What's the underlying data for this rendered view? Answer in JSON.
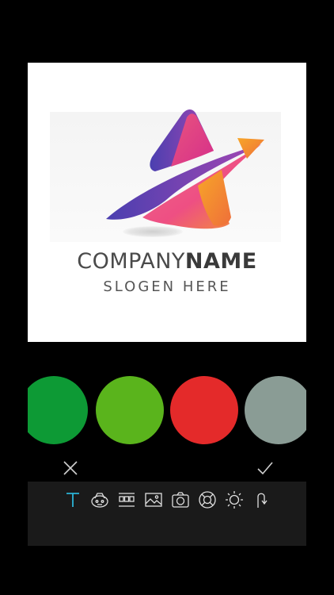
{
  "canvas": {
    "company_name_light": "COMPANY",
    "company_name_bold": "NAME",
    "slogan": "SLOGEN HERE"
  },
  "colors": {
    "logo_gradient": [
      "#e43e8c",
      "#f48a2c",
      "#5a3db4"
    ],
    "swatches": [
      "#0d9a35",
      "#5ab41c",
      "#e42a2a",
      "#8a9c95"
    ],
    "toolbar_active": "#2bb3d6",
    "toolbar_icon": "#e0e0e0"
  },
  "swatches": [
    {
      "name": "dark-green",
      "color": "#0d9a35"
    },
    {
      "name": "lime-green",
      "color": "#5ab41c"
    },
    {
      "name": "red",
      "color": "#e42a2a"
    },
    {
      "name": "gray",
      "color": "#8a9c95"
    }
  ],
  "actions": {
    "cancel_icon": "close-icon",
    "confirm_icon": "checkmark-icon"
  },
  "toolbar": {
    "tools": [
      {
        "icon": "text-icon",
        "active": true
      },
      {
        "icon": "sticker-icon",
        "active": false
      },
      {
        "icon": "layout-icon",
        "active": false
      },
      {
        "icon": "image-icon",
        "active": false
      },
      {
        "icon": "camera-icon",
        "active": false
      },
      {
        "icon": "lifebuoy-icon",
        "active": false
      },
      {
        "icon": "brightness-icon",
        "active": false
      },
      {
        "icon": "undo-icon",
        "active": false
      }
    ]
  }
}
